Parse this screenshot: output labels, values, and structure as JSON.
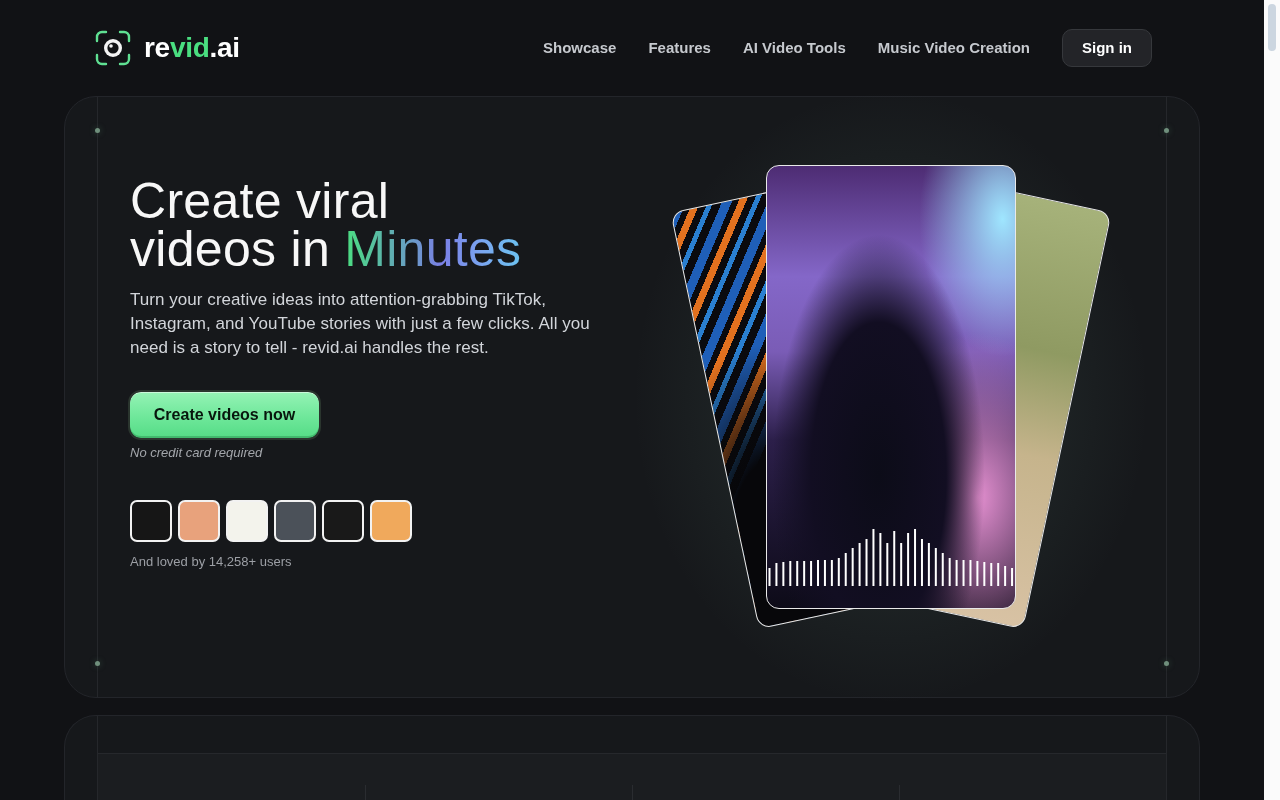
{
  "nav": {
    "logo": [
      {
        "text": "re",
        "accent": false
      },
      {
        "text": "vid",
        "accent": true
      },
      {
        "text": ".ai",
        "accent": false
      }
    ],
    "links": [
      "Showcase",
      "Features",
      "AI Video Tools",
      "Music Video Creation"
    ],
    "sign_in": "Sign in"
  },
  "hero": {
    "headline": [
      {
        "text": "Create viral videos in ",
        "accent": false
      },
      {
        "text": "Minutes",
        "accent": true
      }
    ],
    "description": "Turn your creative ideas into attention-grabbing TikTok, Instagram, and YouTube stories with just a few clicks. All you need is a story to tell - revid.ai handles the rest.",
    "cta": "Create videos now",
    "cta_note": "No credit card required",
    "avatars": [
      {
        "color": "#161616"
      },
      {
        "color": "#e8a27c"
      },
      {
        "color": "#f3f3ec"
      },
      {
        "color": "#4b5159"
      },
      {
        "color": "#191919"
      },
      {
        "color": "#f0a95c"
      }
    ],
    "social_proof": "And loved by 14,258+ users",
    "previews": [
      {
        "kind": "abstract"
      },
      {
        "kind": "concert"
      },
      {
        "kind": "cartoon"
      }
    ]
  }
}
